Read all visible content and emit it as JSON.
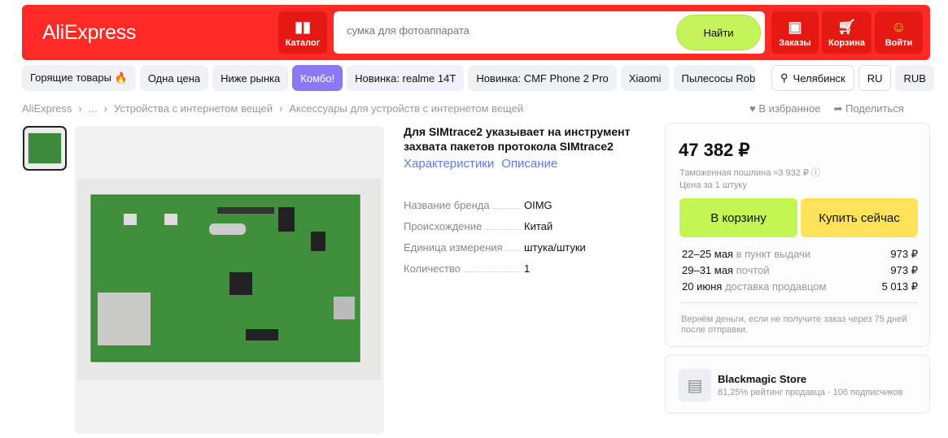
{
  "header": {
    "logo": "AliExpress",
    "catalog": "Каталог",
    "search_placeholder": "сумка для фотоаппарата",
    "find": "Найти",
    "orders": "Заказы",
    "cart": "Корзина",
    "login": "Войти"
  },
  "chips": [
    "Горящие товары 🔥",
    "Одна цена",
    "Ниже рынка",
    "Комбо!",
    "Новинка: realme 14T",
    "Новинка: CMF Phone 2 Pro",
    "Xiaomi",
    "Пылесосы Rob"
  ],
  "location": "Челябинск",
  "lang": "RU",
  "currency": "RUB",
  "breadcrumb": [
    "AliExpress",
    "...",
    "Устройства с интернетом вещей",
    "Аксессуары для устройств с интернетом вещей"
  ],
  "actions": {
    "favorite": "В избранное",
    "share": "Поделиться"
  },
  "product": {
    "title": "Для SIMtrace2 указывает на инструмент захвата пакетов протокола SIMtrace2",
    "tabs": [
      "Характеристики",
      "Описание"
    ],
    "specs": [
      {
        "k": "Название бренда",
        "v": "OIMG"
      },
      {
        "k": "Происхождение",
        "v": "Китай"
      },
      {
        "k": "Единица измерения",
        "v": "штука/штуки"
      },
      {
        "k": "Количество",
        "v": "1"
      }
    ]
  },
  "pricing": {
    "price": "47 382 ₽",
    "duty": "Таможенная пошлина ≈3 932 ₽",
    "unit": "Цена за 1 штуку",
    "add_to_cart": "В корзину",
    "buy_now": "Купить сейчас",
    "delivery": [
      {
        "date": "22–25 мая",
        "method": "в пункт выдачи",
        "price": "973 ₽"
      },
      {
        "date": "29–31 мая",
        "method": "почтой",
        "price": "973 ₽"
      },
      {
        "date": "20 июня",
        "method": "доставка продавцом",
        "price": "5 013 ₽"
      }
    ],
    "guarantee": "Вернём деньги, если не получите заказ через 75 дней после отправки."
  },
  "store": {
    "name": "Blackmagic Store",
    "rating": "81,25% рейтинг продавца",
    "followers": "106 подписчиков"
  }
}
